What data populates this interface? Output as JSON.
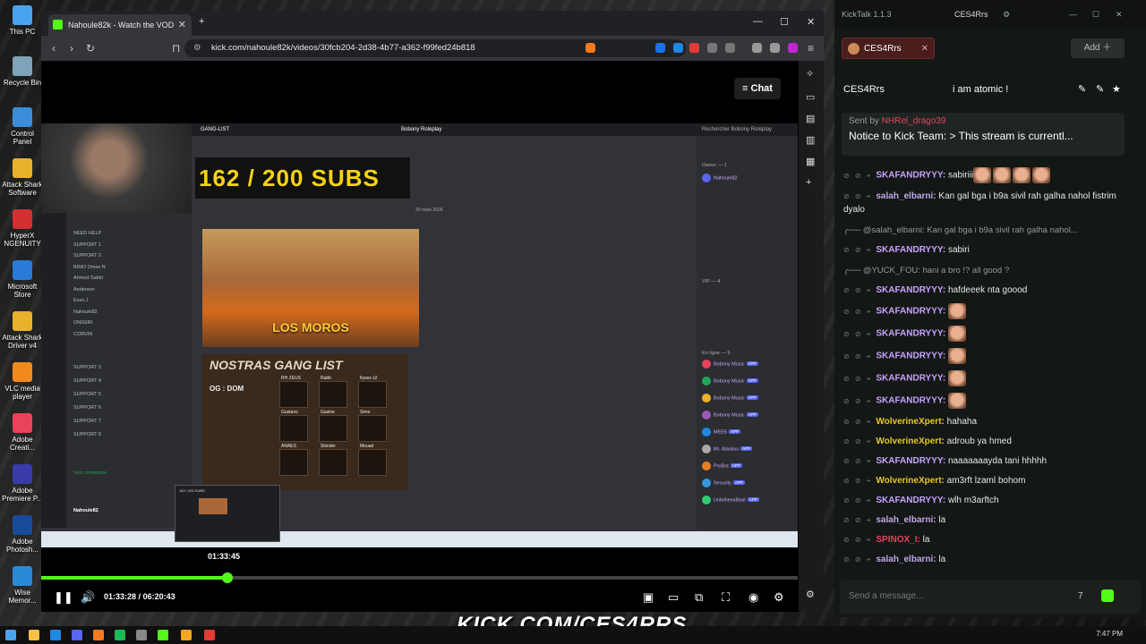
{
  "desktop": {
    "icons": [
      {
        "label": "This PC"
      },
      {
        "label": "Recycle Bin"
      },
      {
        "label": "Control Panel"
      },
      {
        "label": "Attack Shark Software"
      },
      {
        "label": "HyperX NGENUITY"
      },
      {
        "label": "Microsoft Store"
      },
      {
        "label": "Attack Shark Driver v4"
      },
      {
        "label": "VLC media player"
      },
      {
        "label": "Adobe Creati..."
      },
      {
        "label": "Adobe Premiere P..."
      },
      {
        "label": "Adobe Photosh..."
      },
      {
        "label": "Wise Memor..."
      }
    ]
  },
  "browser": {
    "tab_title": "Nahoule82k - Watch the VOD",
    "new_tab": "+",
    "tab_close": "✕",
    "url": "kick.com/nahoule82k/videos/30fcb204-2d38-4b77-a362-f99fed24b818",
    "win_min": "—",
    "win_max": "☐",
    "win_close": "✕",
    "chat_button": "Chat",
    "chat_glyph": "≡"
  },
  "video": {
    "discord_title": "Bobony Roleplay",
    "channel": "GANG-LIST",
    "search_placeholder": "Rechercher Bobony Roleplay",
    "subs_text": "162 / 200  SUBS",
    "date_label": "30 mars 2026",
    "poster1_label": "LOS MOROS",
    "poster2_label": "NOSTRAS GANG LIST",
    "og_label": "OG : DOM",
    "cells": [
      "RH ZEUS",
      "Rabb",
      "Ilyass x2",
      "Gustavo",
      "Gasine",
      "Simo",
      "ANAES",
      "Skinder",
      "Mouad"
    ],
    "left_channels": [
      "NEED HELP",
      "SUPPORT 1",
      "SUPPORT 2",
      "BIMO Omes N",
      "Ahmed Sabiri",
      "Anderson",
      "Esso.J",
      "Nahoule82",
      "ONIGIRI",
      "CORVIN",
      "SUPPORT 3",
      "SUPPORT 4",
      "SUPPORT 5",
      "SUPPORT 6",
      "SUPPORT 7",
      "SUPPORT 8"
    ],
    "voice_status": "Voix connectée",
    "user_name": "Nahoule82",
    "members_header_owner": "Owner — 1",
    "members_header_vip": "VIP — 4",
    "members_header_online": "En ligne — 9",
    "members": [
      "Nahoule82",
      "Bobony Music",
      "Bobony Music",
      "Bobony Music",
      "Bobony Music",
      "MEE6",
      "Mr. Alaskus",
      "ProBot",
      "Security",
      "UnbelievaBoat"
    ],
    "app_badge": "APP",
    "thumb_title": "162 / 200 SUBS",
    "hover_time": "01:33:45",
    "current_time": "01:33:28",
    "duration": "06:20:43",
    "time_separator": "/",
    "progress_fraction": 0.246
  },
  "kicktalk": {
    "app_title": "KickTalk 1.1.3",
    "title_channel": "CES4Rrs",
    "tab_name": "CES4Rrs",
    "add_label": "Add",
    "header_channel": "CES4Rrs",
    "header_title": "i am atomic !",
    "notice_sender_prefix": "Sent by",
    "notice_sender": "NHRel_drago39",
    "notice_text": "Notice to Kick Team: > This stream is currentl...",
    "input_placeholder": "Send a message...",
    "messages": [
      {
        "type": "msg",
        "user": "SKAFANDRYYY:",
        "color": "#c8a2ff",
        "text": "sabiriii",
        "emotes": 4
      },
      {
        "type": "msg",
        "user": "salah_elbarni:",
        "color": "#bfa8e8",
        "text": "Kan gal bga i b9a sivil rah galha nahol fistrim dyalo",
        "emotes": 0
      },
      {
        "type": "reply",
        "text": "@salah_elbarni: Kan gal bga i b9a sivil rah galha nahol..."
      },
      {
        "type": "msg",
        "user": "SKAFANDRYYY:",
        "color": "#c8a2ff",
        "text": "sabiri",
        "emotes": 0
      },
      {
        "type": "reply",
        "text": "@YUCK_FOU: hani a bro !? all good ?"
      },
      {
        "type": "msg",
        "user": "SKAFANDRYYY:",
        "color": "#c8a2ff",
        "text": "hafdeeek nta goood",
        "emotes": 0
      },
      {
        "type": "msg",
        "user": "SKAFANDRYYY:",
        "color": "#c8a2ff",
        "text": "",
        "emotes": 1
      },
      {
        "type": "msg",
        "user": "SKAFANDRYYY:",
        "color": "#c8a2ff",
        "text": "",
        "emotes": 1
      },
      {
        "type": "msg",
        "user": "SKAFANDRYYY:",
        "color": "#c8a2ff",
        "text": "",
        "emotes": 1
      },
      {
        "type": "msg",
        "user": "SKAFANDRYYY:",
        "color": "#c8a2ff",
        "text": "",
        "emotes": 1
      },
      {
        "type": "msg",
        "user": "SKAFANDRYYY:",
        "color": "#c8a2ff",
        "text": "",
        "emotes": 1
      },
      {
        "type": "msg",
        "user": "WolverineXpert:",
        "color": "#e6c72a",
        "text": "hahaha",
        "emotes": 0
      },
      {
        "type": "msg",
        "user": "WolverineXpert:",
        "color": "#e6c72a",
        "text": "adroub ya hmed",
        "emotes": 0
      },
      {
        "type": "msg",
        "user": "SKAFANDRYYY:",
        "color": "#c8a2ff",
        "text": "naaaaaaayda tani hhhhh",
        "emotes": 0
      },
      {
        "type": "msg",
        "user": "WolverineXpert:",
        "color": "#e6c72a",
        "text": "am3rft lzaml bohom",
        "emotes": 0
      },
      {
        "type": "msg",
        "user": "SKAFANDRYYY:",
        "color": "#c8a2ff",
        "text": "wlh m3arftch",
        "emotes": 0
      },
      {
        "type": "msg",
        "user": "salah_elbarni:",
        "color": "#bfa8e8",
        "text": "la",
        "emotes": 0
      },
      {
        "type": "msg",
        "user": "SPINOX_I:",
        "color": "#e8435a",
        "text": "la",
        "emotes": 0
      },
      {
        "type": "msg",
        "user": "salah_elbarni:",
        "color": "#bfa8e8",
        "text": "la",
        "emotes": 0
      }
    ]
  },
  "overlay": {
    "text": "KICK.COM/CES4RRS"
  },
  "taskbar": {
    "time": "7:47 PM"
  },
  "colors": {
    "kick_green": "#53fc18",
    "chat_bg": "#131715"
  }
}
